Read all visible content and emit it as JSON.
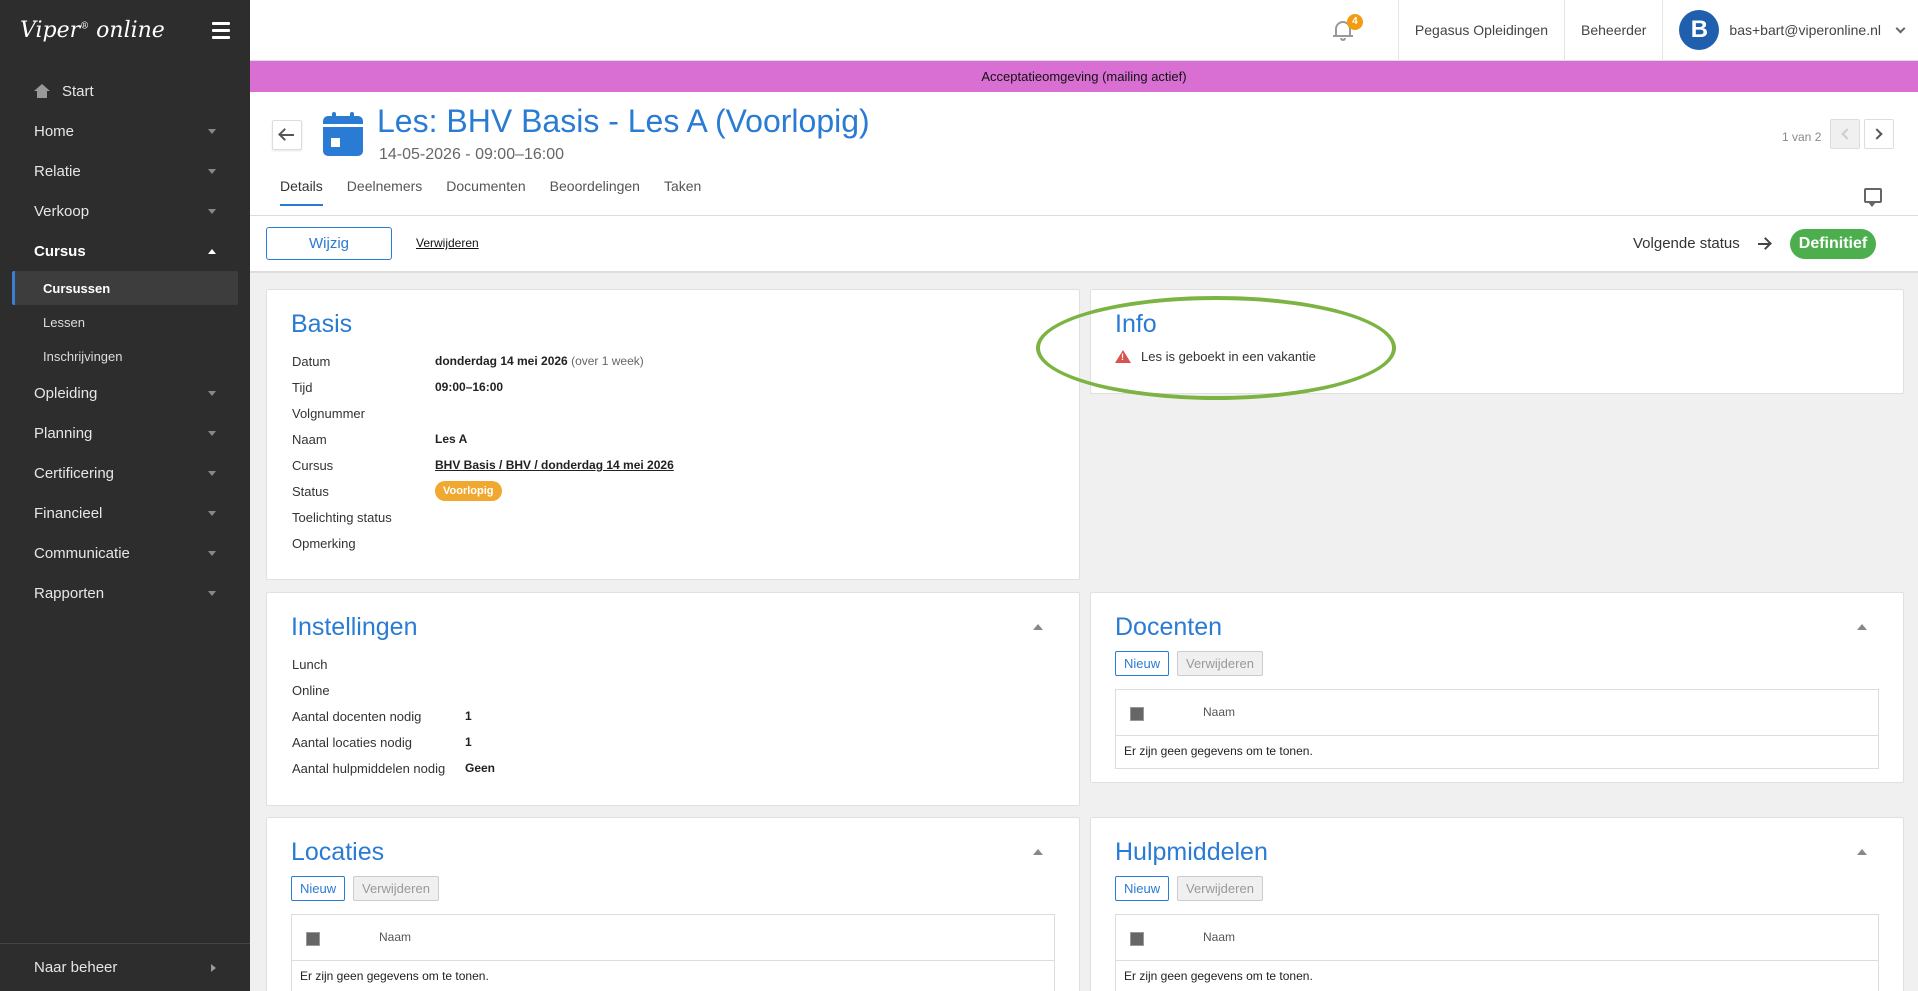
{
  "app": {
    "logo": "Viper",
    "logo_mark": "®",
    "logo_suffix": "online"
  },
  "sidebar": {
    "start": "Start",
    "items": [
      {
        "label": "Home"
      },
      {
        "label": "Relatie"
      },
      {
        "label": "Verkoop"
      },
      {
        "label": "Cursus"
      },
      {
        "label": "Opleiding"
      },
      {
        "label": "Planning"
      },
      {
        "label": "Certificering"
      },
      {
        "label": "Financieel"
      },
      {
        "label": "Communicatie"
      },
      {
        "label": "Rapporten"
      }
    ],
    "subitems": [
      "Cursussen",
      "Lessen",
      "Inschrijvingen"
    ],
    "bottom": "Naar beheer"
  },
  "topbar": {
    "notification_count": "4",
    "organisation": "Pegasus Opleidingen",
    "role": "Beheerder",
    "avatar_letter": "B",
    "user_email": "bas+bart@viperonline.nl"
  },
  "env_banner": "Acceptatieomgeving (mailing actief)",
  "header": {
    "title": "Les: BHV Basis - Les A (Voorlopig)",
    "subtitle": "14-05-2026 - 09:00–16:00",
    "pager": "1 van 2",
    "tabs": [
      "Details",
      "Deelnemers",
      "Documenten",
      "Beoordelingen",
      "Taken"
    ]
  },
  "actions": {
    "edit": "Wijzig",
    "delete": "Verwijderen",
    "next_status_label": "Volgende status",
    "next_status": "Definitief"
  },
  "basis": {
    "title": "Basis",
    "labels": {
      "datum": "Datum",
      "tijd": "Tijd",
      "volgnummer": "Volgnummer",
      "naam": "Naam",
      "cursus": "Cursus",
      "status": "Status",
      "toelichting": "Toelichting status",
      "opmerking": "Opmerking"
    },
    "values": {
      "datum": "donderdag 14 mei 2026",
      "datum_rel": "(over 1 week)",
      "tijd": "09:00–16:00",
      "naam": "Les A",
      "cursus": "BHV Basis / BHV / donderdag 14 mei 2026",
      "status": "Voorlopig"
    }
  },
  "info": {
    "title": "Info",
    "warning": "Les is geboekt in een vakantie"
  },
  "instellingen": {
    "title": "Instellingen",
    "labels": {
      "lunch": "Lunch",
      "online": "Online",
      "docenten": "Aantal docenten nodig",
      "locaties": "Aantal locaties nodig",
      "hulpmiddelen": "Aantal hulpmiddelen nodig"
    },
    "values": {
      "docenten": "1",
      "locaties": "1",
      "hulpmiddelen": "Geen"
    }
  },
  "docenten": {
    "title": "Docenten",
    "new": "Nieuw",
    "delete": "Verwijderen",
    "col": "Naam",
    "empty": "Er zijn geen gegevens om te tonen."
  },
  "locaties": {
    "title": "Locaties",
    "new": "Nieuw",
    "delete": "Verwijderen",
    "col": "Naam",
    "empty": "Er zijn geen gegevens om te tonen."
  },
  "hulpmiddelen": {
    "title": "Hulpmiddelen",
    "new": "Nieuw",
    "delete": "Verwijderen",
    "col": "Naam",
    "empty": "Er zijn geen gegevens om te tonen."
  },
  "colors": {
    "accent": "#2a7bd3",
    "sidebar": "#2d2d2d",
    "env": "#d96fd3",
    "success": "#4cae4c",
    "warning_pill": "#f0a830"
  }
}
